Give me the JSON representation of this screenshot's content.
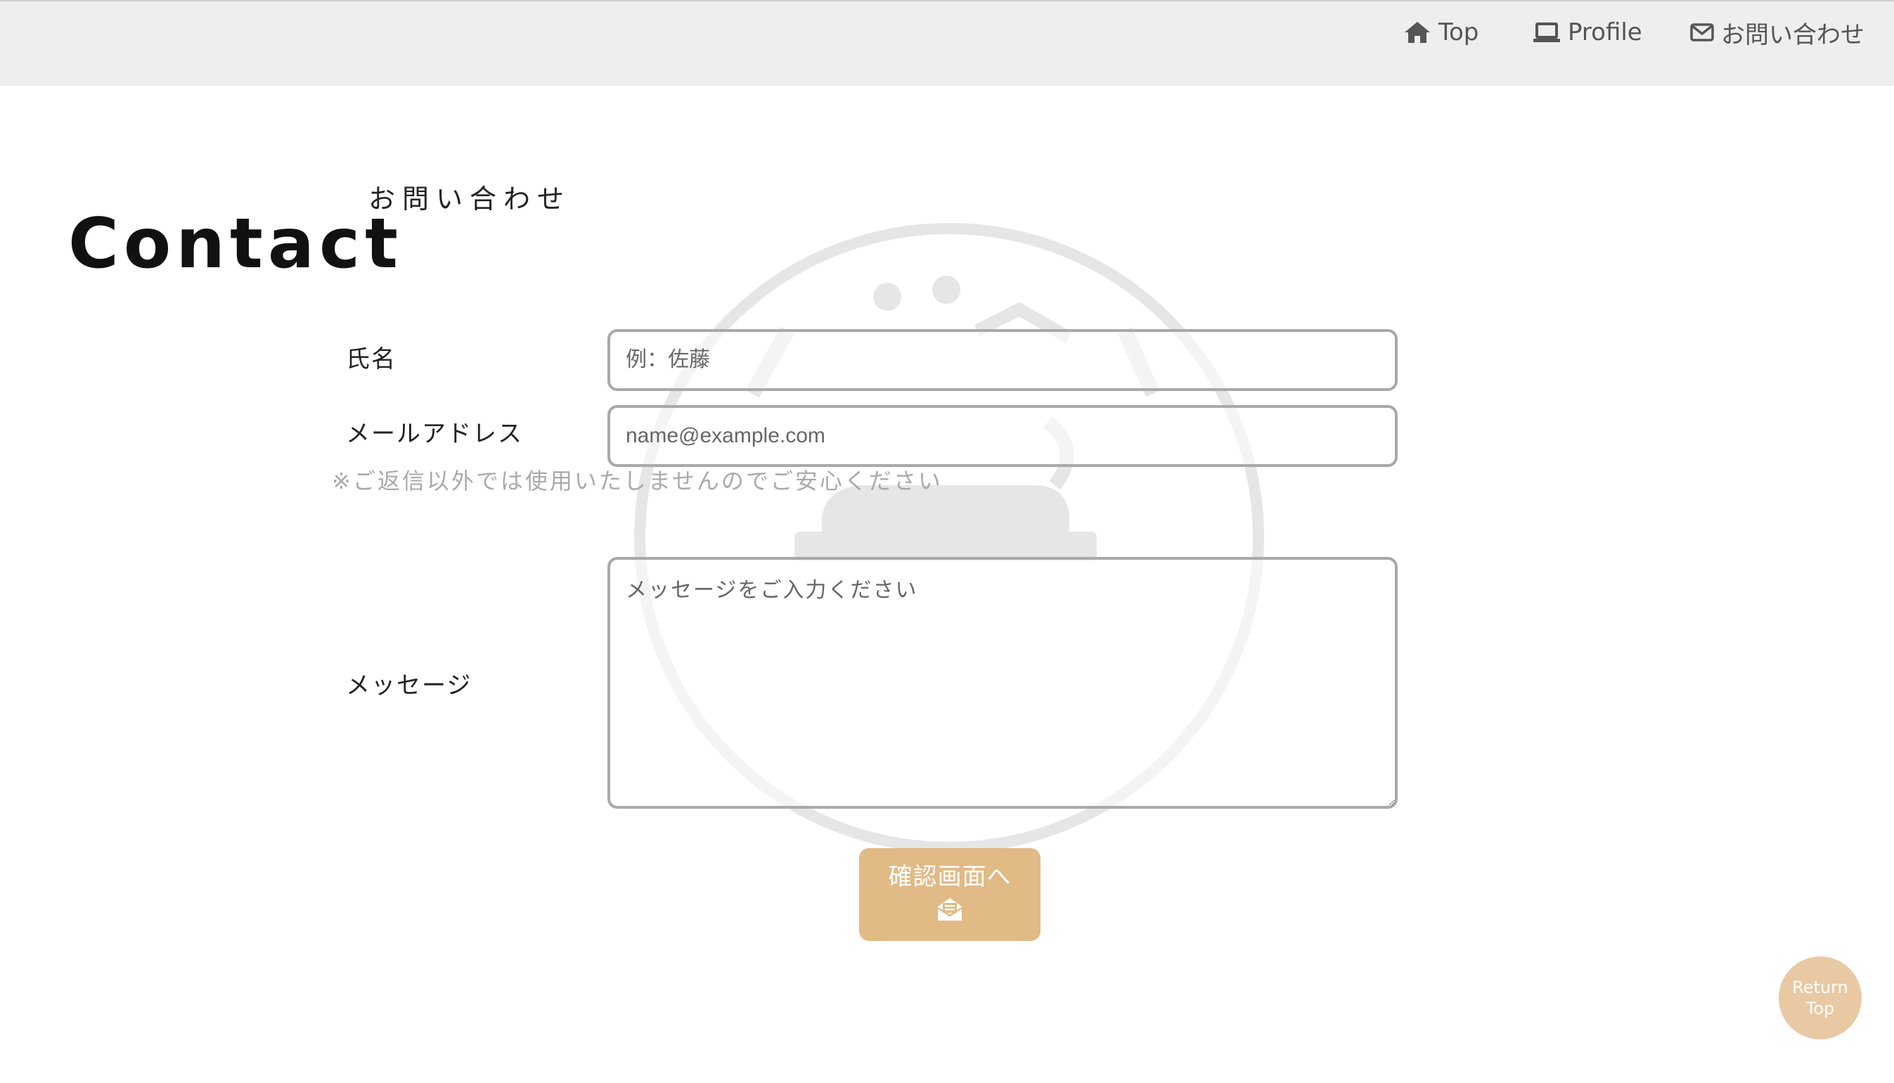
{
  "nav": {
    "items": [
      {
        "label": "Top",
        "icon": "home-icon"
      },
      {
        "label": "Profile",
        "icon": "laptop-icon"
      },
      {
        "label": "お問い合わせ",
        "icon": "envelope-icon"
      }
    ]
  },
  "page": {
    "title": "Contact",
    "subtitle": "お問い合わせ"
  },
  "form": {
    "name_label": "氏名",
    "name_placeholder": "例：佐藤",
    "name_value": "",
    "email_label": "メールアドレス",
    "email_placeholder": "name@example.com",
    "email_value": "",
    "email_note": "※ご返信以外では使用いたしませんのでご安心ください",
    "message_label": "メッセージ",
    "message_placeholder": "メッセージをご入力ください",
    "message_value": "",
    "submit_label": "確認画面へ",
    "submit_icon": "envelope-open-icon"
  },
  "return_top": {
    "line1": "Return",
    "line2": "Top"
  },
  "colors": {
    "header_bg": "#eeeeee",
    "accent": "#e1ba86",
    "return_top_bg": "#e8c9a4",
    "input_border": "#a9a9a9",
    "watermark": "#e6e6e6"
  }
}
